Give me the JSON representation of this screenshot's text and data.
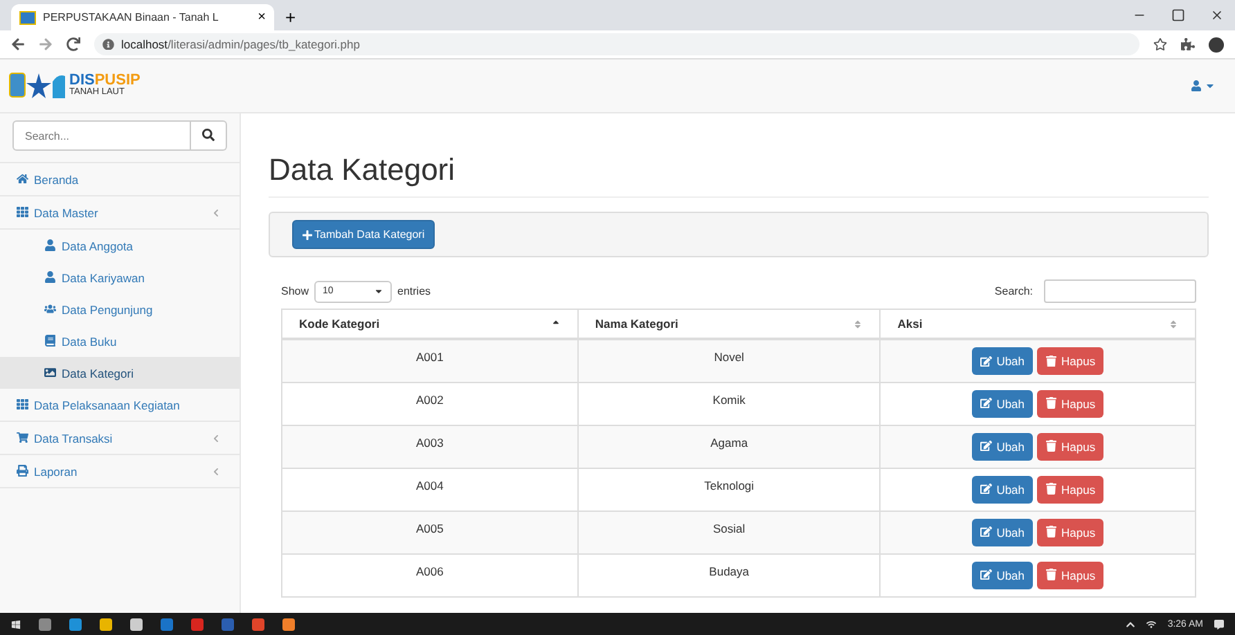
{
  "browser": {
    "tab_title": "PERPUSTAKAAN Binaan - Tanah L",
    "tab_close": "×",
    "new_tab": "+",
    "url": "**localhost**/literasi/admin/pages/tb_kategori.php"
  },
  "logo": {
    "part_1": "DIS",
    "part_2": "PUSIP",
    "subtitle": "TANAH LAUT"
  },
  "sidebar": {
    "search": {
      "placeholder": "Search..."
    },
    "items": [
      {
        "label": "Beranda",
        "kind": "home",
        "has_submenu": false,
        "selected": false
      },
      {
        "label": "Data Master",
        "kind": "grid",
        "has_submenu": true,
        "selected": false,
        "children": [
          {
            "label": "Data Anggota",
            "kind": "user",
            "selected": false
          },
          {
            "label": "Data Kariyawan",
            "kind": "user",
            "selected": false
          },
          {
            "label": "Data Pengunjung",
            "kind": "users",
            "selected": false
          },
          {
            "label": "Data Buku",
            "kind": "book",
            "selected": false
          },
          {
            "label": "Data Kategori",
            "kind": "image",
            "selected": true
          }
        ]
      },
      {
        "label": "Data Pelaksanaan Kegiatan",
        "kind": "grid",
        "has_submenu": false,
        "selected": false
      },
      {
        "label": "Data Transaksi",
        "kind": "cart",
        "has_submenu": true,
        "selected": false
      },
      {
        "label": "Laporan",
        "kind": "print",
        "has_submenu": true,
        "selected": false
      }
    ]
  },
  "page_title": "Data Kategori",
  "add_button": "Tambah Data Kategori",
  "length": {
    "show": "Show",
    "value": "10",
    "entries": "entries"
  },
  "search_label": "Search:",
  "table": {
    "columns": [
      {
        "label": "Kode Kategori",
        "sorted_ascending": true
      },
      {
        "label": "Nama Kategori",
        "sorted_ascending": false
      },
      {
        "label": "Aksi",
        "sorted_ascending": false
      }
    ],
    "rows": [
      {
        "code": "A001",
        "name": "Novel",
        "edit": "Ubah",
        "delete": "Hapus"
      },
      {
        "code": "A002",
        "name": "Komik",
        "edit": "Ubah",
        "delete": "Hapus"
      },
      {
        "code": "A003",
        "name": "Agama",
        "edit": "Ubah",
        "delete": "Hapus"
      },
      {
        "code": "A004",
        "name": "Teknologi",
        "edit": "Ubah",
        "delete": "Hapus"
      },
      {
        "code": "A005",
        "name": "Sosial",
        "edit": "Ubah",
        "delete": "Hapus"
      },
      {
        "code": "A006",
        "name": "Budaya",
        "edit": "Ubah",
        "delete": "Hapus"
      }
    ]
  },
  "taskbar": {
    "time": "3:26 AM"
  }
}
